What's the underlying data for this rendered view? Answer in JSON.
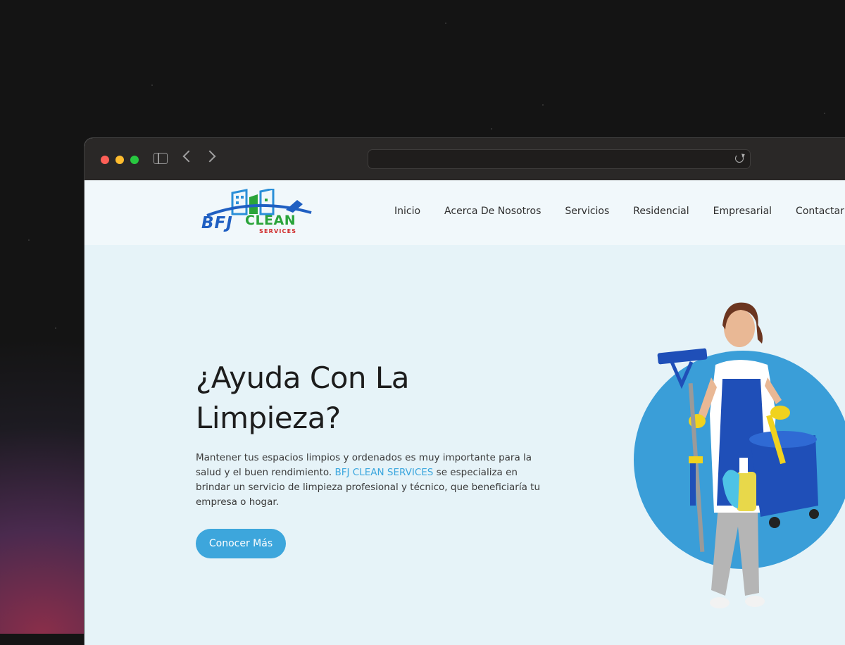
{
  "colors": {
    "accent": "#3da6dc",
    "brand_link": "#3aa6de",
    "logo_blue": "#1f5fc2",
    "logo_green": "#2aa43a",
    "logo_red": "#d02a2a",
    "hero_circle": "#3a9ed8"
  },
  "browser": {
    "icons": [
      "sidebar-toggle-icon",
      "back-arrow-icon",
      "forward-arrow-icon",
      "reload-icon"
    ]
  },
  "logo": {
    "word1": "BFJ",
    "word2": "CLEAN",
    "word3": "SERVICES"
  },
  "nav": {
    "items": [
      {
        "label": "Inicio"
      },
      {
        "label": "Acerca De Nosotros"
      },
      {
        "label": "Servicios"
      },
      {
        "label": "Residencial"
      },
      {
        "label": "Empresarial"
      },
      {
        "label": "Contactar"
      }
    ]
  },
  "hero": {
    "title_line1": "¿Ayuda Con La",
    "title_line2": "Limpieza?",
    "text_before": "Mantener tus espacios limpios y ordenados es muy importante para la salud y el buen rendimiento. ",
    "brand_name": "BFJ CLEAN SERVICES",
    "text_after": " se especializa en brindar un servicio de limpieza profesional y técnico, que beneficiaría tu empresa o hogar.",
    "cta_label": "Conocer Más"
  }
}
